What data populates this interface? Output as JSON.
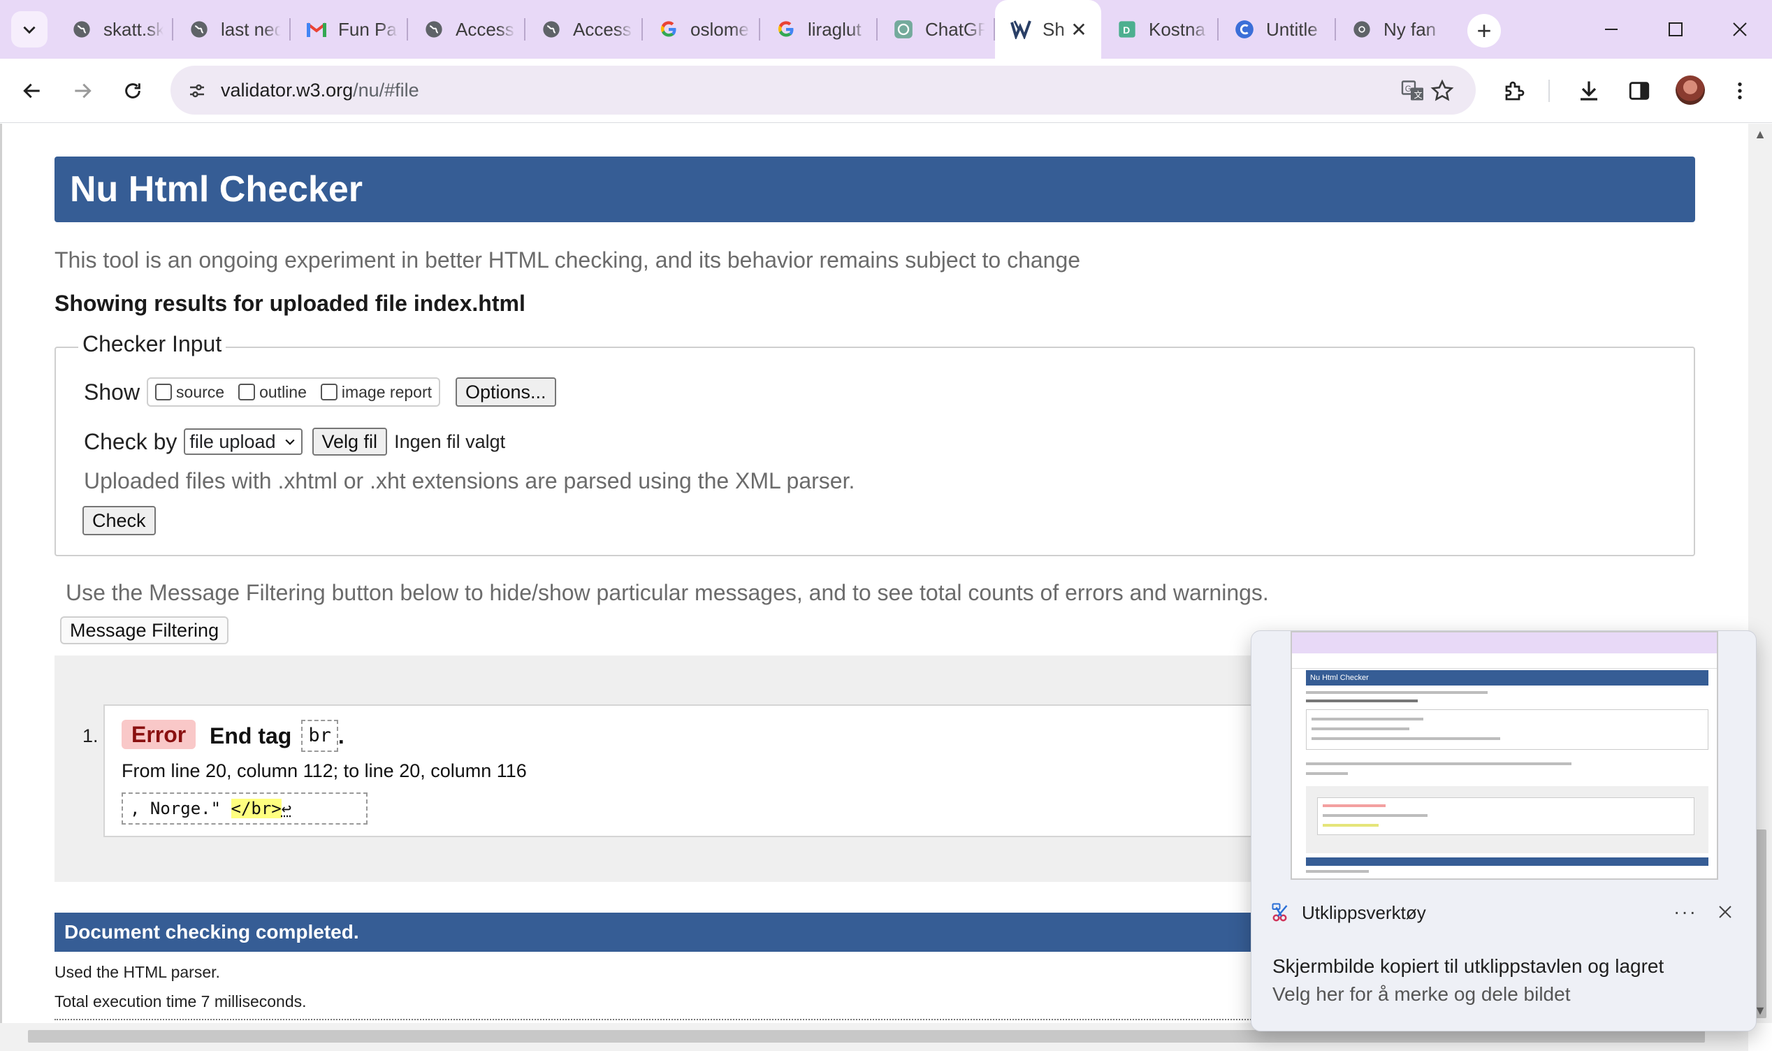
{
  "browser": {
    "tabs": [
      {
        "title": "skatt.sk",
        "icon": "globe-icon"
      },
      {
        "title": "last ned",
        "icon": "globe-icon"
      },
      {
        "title": "Fun Pa",
        "icon": "gmail-icon"
      },
      {
        "title": "Access",
        "icon": "globe-icon"
      },
      {
        "title": "Access",
        "icon": "globe-icon"
      },
      {
        "title": "oslome",
        "icon": "google-icon"
      },
      {
        "title": "liraglut",
        "icon": "google-icon"
      },
      {
        "title": "ChatGP",
        "icon": "chatgpt-icon"
      },
      {
        "title": "Sh",
        "icon": "w3c-validator-icon",
        "active": true
      },
      {
        "title": "Kostna",
        "icon": "doc-icon"
      },
      {
        "title": "Untitle",
        "icon": "canva-icon"
      },
      {
        "title": "Ny fan",
        "icon": "chrome-icon"
      }
    ],
    "url_host": "validator.w3.org",
    "url_path": "/nu/#file",
    "accent": "#e8d9f7"
  },
  "page": {
    "title": "Nu Html Checker",
    "intro": "This tool is an ongoing experiment in better HTML checking, and its behavior remains subject to change",
    "results_for": "Showing results for uploaded file index.html",
    "checker_input": {
      "legend": "Checker Input",
      "show_label": "Show",
      "show_options": [
        "source",
        "outline",
        "image report"
      ],
      "options_button": "Options...",
      "check_by_label": "Check by",
      "check_by_value": "file upload",
      "choose_file_button": "Velg fil",
      "no_file_text": "Ingen fil valgt",
      "xml_note": "Uploaded files with .xhtml or .xht extensions are parsed using the XML parser.",
      "check_button": "Check"
    },
    "filter_note": "Use the Message Filtering button below to hide/show particular messages, and to see total counts of errors and warnings.",
    "filter_button": "Message Filtering",
    "messages": [
      {
        "number": "1.",
        "type": "Error",
        "title_prefix": "End tag",
        "code": "br",
        "title_suffix": ".",
        "location": "From line 20, column 112; to line 20, column 116",
        "extract_before": ", Norge.\" ",
        "extract_highlight": "</br>",
        "extract_after": "↩"
      }
    ],
    "done": "Document checking completed.",
    "parser": "Used the HTML parser.",
    "exec_time": "Total execution time 7 milliseconds."
  },
  "toast": {
    "app_name": "Utklippsverktøy",
    "more": "···",
    "title": "Skjermbilde kopiert til utklippstavlen og lagret",
    "subtitle": "Velg her for å merke og dele bildet"
  },
  "colors": {
    "header_blue": "#365d95",
    "error_badge": "#f9c8c8",
    "highlight": "#ffff80"
  }
}
